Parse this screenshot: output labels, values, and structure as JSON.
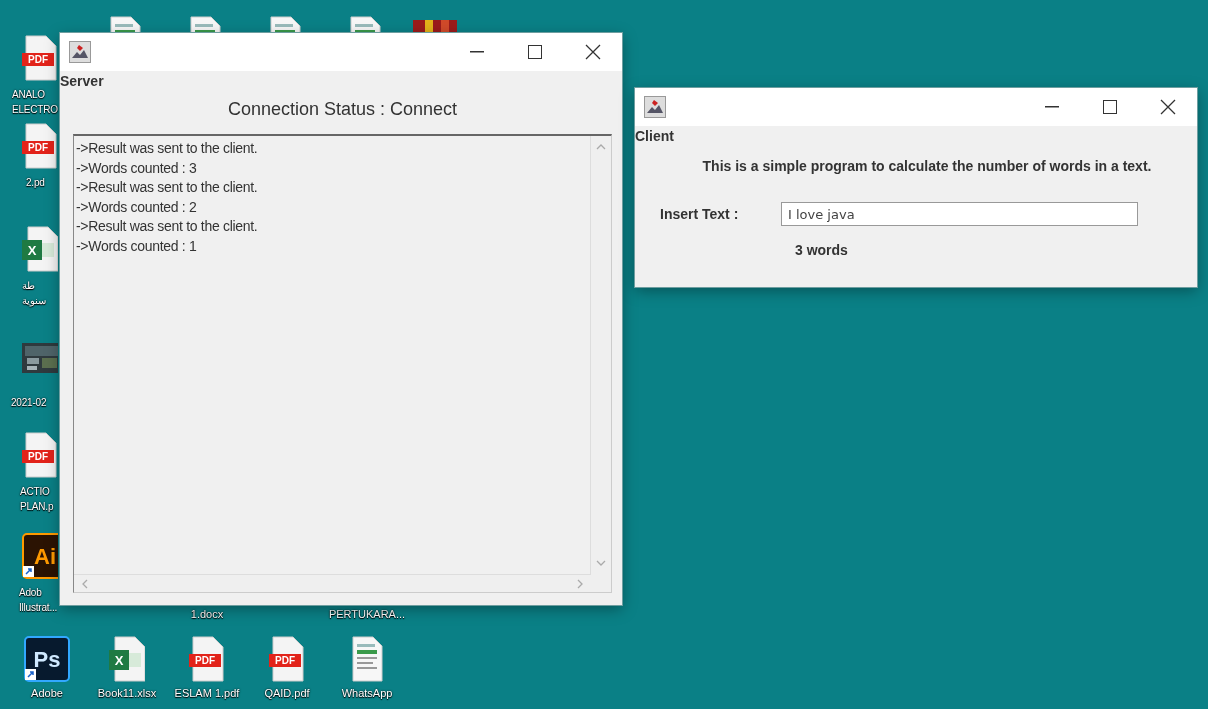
{
  "desktop": {
    "icons": [
      {
        "kind": "pdf",
        "badge": "PDF",
        "lines": [
          "ANALO",
          "ELECTRO"
        ]
      },
      {
        "kind": "pdf",
        "badge": "PDF",
        "lines": [
          "2.pd"
        ]
      },
      {
        "kind": "excel",
        "badge": "X",
        "lines": [
          "طة",
          "سنوية"
        ]
      },
      {
        "kind": "picture",
        "lines": [
          "2021-02"
        ]
      },
      {
        "kind": "pdf",
        "badge": "PDF",
        "lines": [
          "ACTIO",
          "PLAN.p"
        ]
      },
      {
        "kind": "ai",
        "badge": "Ai",
        "lines": [
          "Adob",
          "Illustrat..."
        ]
      },
      {
        "kind": "ps",
        "badge": "Ps",
        "lines": [
          "Adobe"
        ]
      },
      {
        "kind": "excel",
        "badge": "X",
        "lines": [
          "Book11.xlsx"
        ]
      },
      {
        "kind": "pdf",
        "badge": "PDF",
        "lines": [
          "ESLAM 1.pdf"
        ]
      },
      {
        "kind": "pdf",
        "badge": "PDF",
        "lines": [
          "QAID.pdf"
        ]
      },
      {
        "kind": "document",
        "lines": [
          "WhatsApp"
        ]
      },
      {
        "kind": "label",
        "lines": [
          "1.docx"
        ]
      },
      {
        "kind": "label",
        "lines": [
          "PERTUKARA..."
        ]
      },
      {
        "kind": "document"
      },
      {
        "kind": "document"
      },
      {
        "kind": "document"
      },
      {
        "kind": "document"
      },
      {
        "kind": "archive"
      }
    ]
  },
  "server": {
    "label": "Server",
    "status": "Connection Status : Connect",
    "log": [
      "->Result was sent to the client.",
      "->Words counted : 3",
      "->Result was sent to the client.",
      "->Words counted : 2",
      "->Result was sent to the client.",
      "->Words counted : 1"
    ]
  },
  "client": {
    "label": "Client",
    "description": "This is a simple program to calculate the number of words in a text.",
    "input_label": "Insert Text :",
    "input_value": "I love java",
    "result": "3 words"
  }
}
